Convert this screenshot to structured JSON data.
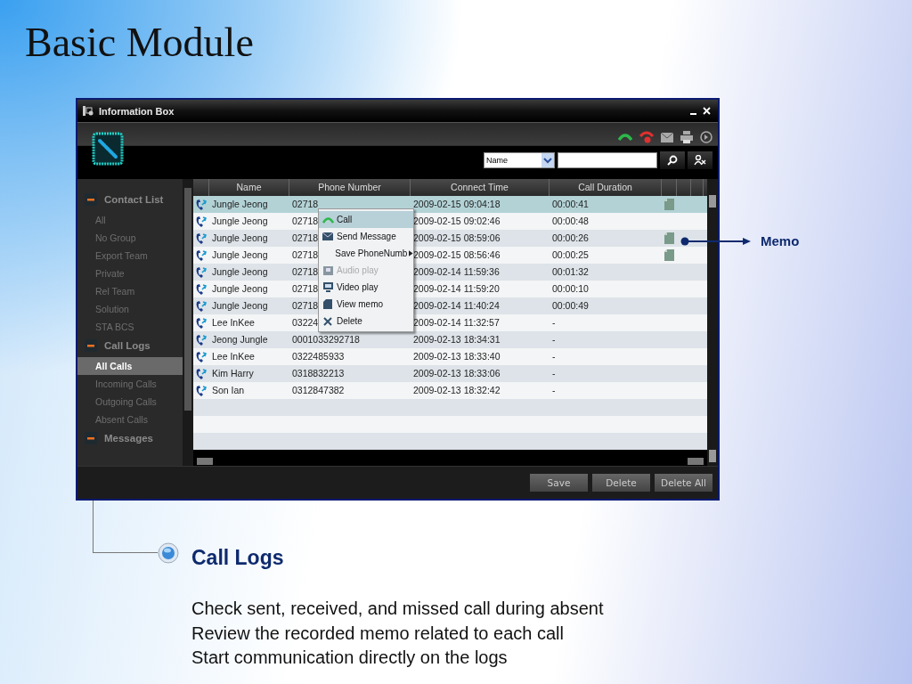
{
  "slide_title": "Basic Module",
  "window": {
    "title": "Information Box",
    "search": {
      "field": "Name"
    },
    "sidebar": [
      {
        "label": "Contact List",
        "expanded": true,
        "items": [
          {
            "label": "All",
            "selected": false
          },
          {
            "label": "No Group",
            "selected": false
          },
          {
            "label": "Export Team",
            "selected": false
          },
          {
            "label": "Private",
            "selected": false
          },
          {
            "label": "Rel Team",
            "selected": false
          },
          {
            "label": "Solution",
            "selected": false
          },
          {
            "label": "STA BCS",
            "selected": false
          }
        ]
      },
      {
        "label": "Call Logs",
        "expanded": true,
        "items": [
          {
            "label": "All Calls",
            "selected": true
          },
          {
            "label": "Incoming Calls",
            "selected": false
          },
          {
            "label": "Outgoing Calls",
            "selected": false
          },
          {
            "label": "Absent Calls",
            "selected": false
          }
        ]
      },
      {
        "label": "Messages",
        "expanded": true
      }
    ],
    "table": {
      "columns": [
        "Name",
        "Phone Number",
        "Connect Time",
        "Call Duration"
      ],
      "rows": [
        {
          "name": "Jungle Jeong",
          "phone": "02718",
          "time": "2009-02-15 09:04:18",
          "duration": "00:00:41",
          "memo": true,
          "selected": true
        },
        {
          "name": "Jungle Jeong",
          "phone": "02718",
          "time": "2009-02-15 09:02:46",
          "duration": "00:00:48",
          "memo": false,
          "selected": false
        },
        {
          "name": "Jungle Jeong",
          "phone": "02718",
          "time": "2009-02-15 08:59:06",
          "duration": "00:00:26",
          "memo": true,
          "selected": false
        },
        {
          "name": "Jungle Jeong",
          "phone": "02718",
          "time": "2009-02-15 08:56:46",
          "duration": "00:00:25",
          "memo": true,
          "selected": false
        },
        {
          "name": "Jungle Jeong",
          "phone": "02718",
          "time": "2009-02-14 11:59:36",
          "duration": "00:01:32",
          "memo": false,
          "selected": false
        },
        {
          "name": "Jungle Jeong",
          "phone": "02718",
          "time": "2009-02-14 11:59:20",
          "duration": "00:00:10",
          "memo": false,
          "selected": false
        },
        {
          "name": "Jungle Jeong",
          "phone": "02718",
          "time": "2009-02-14 11:40:24",
          "duration": "00:00:49",
          "memo": false,
          "selected": false
        },
        {
          "name": "Lee InKee",
          "phone": "03224",
          "time": "2009-02-14 11:32:57",
          "duration": "-",
          "memo": false,
          "selected": false
        },
        {
          "name": "Jeong Jungle",
          "phone": "0001033292718",
          "time": "2009-02-13 18:34:31",
          "duration": "-",
          "memo": false,
          "selected": false
        },
        {
          "name": "Lee InKee",
          "phone": "0322485933",
          "time": "2009-02-13 18:33:40",
          "duration": "-",
          "memo": false,
          "selected": false
        },
        {
          "name": "Kim Harry",
          "phone": "0318832213",
          "time": "2009-02-13 18:33:06",
          "duration": "-",
          "memo": false,
          "selected": false
        },
        {
          "name": "Son Ian",
          "phone": "0312847382",
          "time": "2009-02-13 18:32:42",
          "duration": "-",
          "memo": false,
          "selected": false
        }
      ]
    },
    "context_menu": [
      {
        "label": "Call",
        "kind": "call",
        "selected": true,
        "disabled": false
      },
      {
        "label": "Send Message",
        "kind": "message",
        "selected": false,
        "disabled": false
      },
      {
        "label": "Save PhoneNumb",
        "kind": "submenu",
        "selected": false,
        "disabled": false
      },
      {
        "label": "Audio play",
        "kind": "audio",
        "selected": false,
        "disabled": true
      },
      {
        "label": "Video play",
        "kind": "video",
        "selected": false,
        "disabled": false
      },
      {
        "label": "View memo",
        "kind": "memo",
        "selected": false,
        "disabled": false
      },
      {
        "label": "Delete",
        "kind": "delete",
        "selected": false,
        "disabled": false
      }
    ],
    "buttons": [
      "Save",
      "Delete",
      "Delete All"
    ]
  },
  "annotation": "Memo",
  "callout": {
    "heading": "Call Logs",
    "lines": [
      "Check sent, received, and missed call during absent",
      "Review the recorded memo related to each call",
      "Start communication directly on the logs"
    ]
  }
}
